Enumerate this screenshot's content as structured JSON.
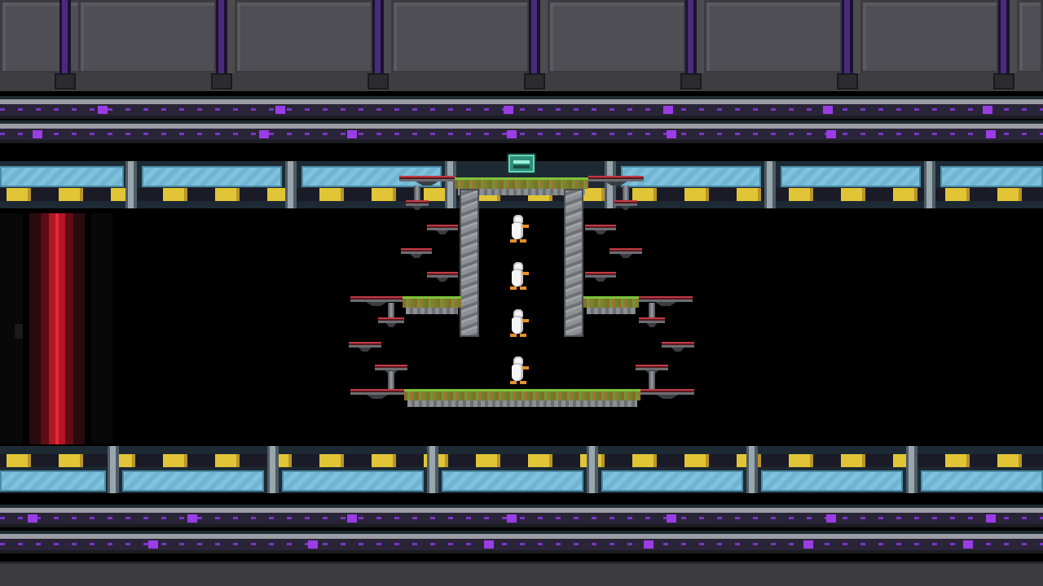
{
  "scene": {
    "title": "",
    "players_visible": 4,
    "colors": {
      "energy_column": "#b31622",
      "glass": "#7fc2de",
      "hazard": "#e2c536",
      "grass": "#7ec23a",
      "rail_accent": "#9b3de6"
    },
    "players": [
      {
        "id": "duck-1",
        "color": "white"
      },
      {
        "id": "duck-2",
        "color": "white"
      },
      {
        "id": "duck-3",
        "color": "white"
      },
      {
        "id": "duck-4",
        "color": "white"
      }
    ],
    "pickups": [
      {
        "id": "item-crate",
        "icon": "weapon-crate-icon",
        "color": "#64d7b6"
      }
    ]
  }
}
